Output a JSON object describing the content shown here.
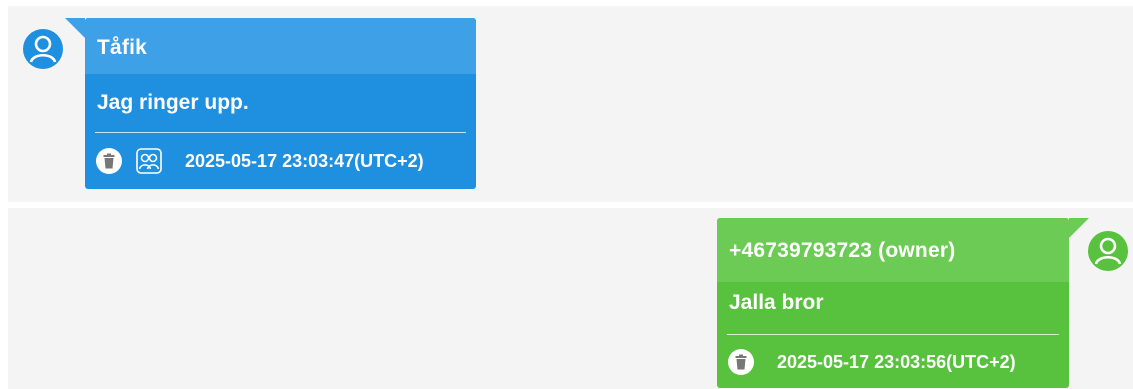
{
  "messages": [
    {
      "sender": "Tåfik",
      "text": "Jag ringer upp.",
      "timestamp": "2025-05-17 23:03:47(UTC+2)",
      "direction": "incoming",
      "icons": [
        "trash-icon",
        "participants-icon"
      ],
      "color": "#1f8fe0",
      "header_color": "#3ea0e6",
      "avatar_color": "#1f8fe0"
    },
    {
      "sender": "+46739793723 (owner)",
      "text": "Jalla bror",
      "timestamp": "2025-05-17 23:03:56(UTC+2)",
      "direction": "outgoing",
      "icons": [
        "trash-icon"
      ],
      "color": "#58c13d",
      "header_color": "#6ccb55",
      "avatar_color": "#58c13d"
    }
  ]
}
